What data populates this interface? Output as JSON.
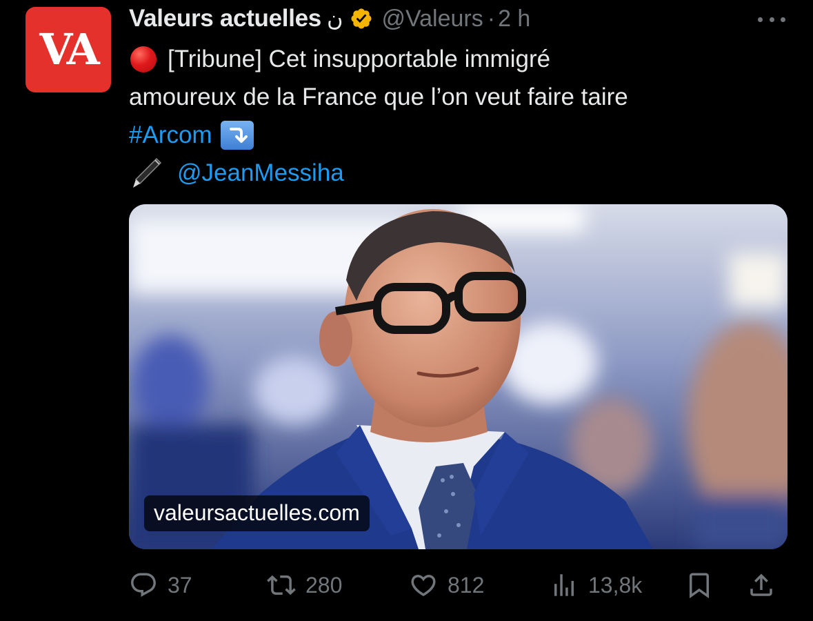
{
  "tweet": {
    "avatar_text": "VA",
    "display_name": "Valeurs actuelles",
    "name_glyph": "ن",
    "handle": "@Valeurs",
    "separator": "·",
    "time": "2 h",
    "lines": {
      "line1": "[Tribune] Cet insupportable immigré",
      "line2": "amoureux de la France que l’on veut faire taire",
      "hashtag": "#Arcom",
      "mention": "@JeanMessiha"
    },
    "media": {
      "domain_label": "valeursactuelles.com"
    },
    "actions": {
      "replies": "37",
      "retweets": "280",
      "likes": "812",
      "views": "13,8k"
    }
  },
  "colors": {
    "background": "#000000",
    "text": "#e7e9ea",
    "muted": "#71767b",
    "link": "#1d9bf0",
    "avatar_bg": "#e4312b",
    "verified_badge": "#f4b400"
  },
  "icons": [
    "more-icon",
    "verified-icon",
    "red-circle-icon",
    "arrow-down-right-icon",
    "pen-icon",
    "reply-icon",
    "retweet-icon",
    "like-icon",
    "views-icon",
    "bookmark-icon",
    "share-icon"
  ]
}
